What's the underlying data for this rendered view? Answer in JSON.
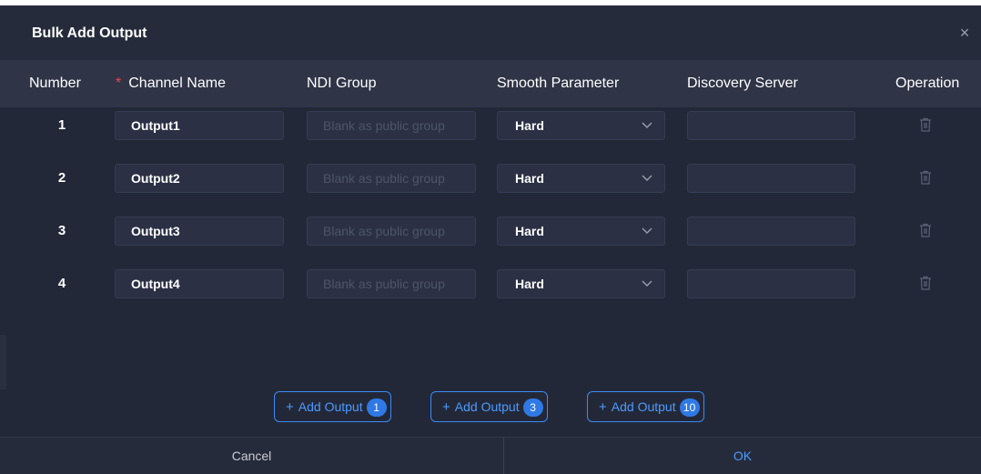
{
  "dialog": {
    "title": "Bulk Add Output",
    "close_icon": "close-icon"
  },
  "columns": {
    "number": "Number",
    "required_marker": "*",
    "channel_name": "Channel Name",
    "ndi_group": "NDI Group",
    "smooth_parameter": "Smooth Parameter",
    "discovery_server": "Discovery Server",
    "operation": "Operation"
  },
  "rows": [
    {
      "number": "1",
      "channel_name": "Output1",
      "ndi_group": "",
      "ndi_group_placeholder": "Blank as public group",
      "smooth": "Hard",
      "discovery_server": "",
      "delete_icon": "trash-icon"
    },
    {
      "number": "2",
      "channel_name": "Output2",
      "ndi_group": "",
      "ndi_group_placeholder": "Blank as public group",
      "smooth": "Hard",
      "discovery_server": "",
      "delete_icon": "trash-icon"
    },
    {
      "number": "3",
      "channel_name": "Output3",
      "ndi_group": "",
      "ndi_group_placeholder": "Blank as public group",
      "smooth": "Hard",
      "discovery_server": "",
      "delete_icon": "trash-icon"
    },
    {
      "number": "4",
      "channel_name": "Output4",
      "ndi_group": "",
      "ndi_group_placeholder": "Blank as public group",
      "smooth": "Hard",
      "discovery_server": "",
      "delete_icon": "trash-icon"
    }
  ],
  "add_buttons": [
    {
      "label": "Add Output",
      "plus": "+",
      "count": "1"
    },
    {
      "label": "Add Output",
      "plus": "+",
      "count": "3"
    },
    {
      "label": "Add Output",
      "plus": "+",
      "count": "10"
    }
  ],
  "footer": {
    "cancel": "Cancel",
    "ok": "OK"
  },
  "colors": {
    "background": "#232838",
    "header": "#2f3446",
    "accent": "#4c9bff",
    "required": "#e5484d"
  }
}
